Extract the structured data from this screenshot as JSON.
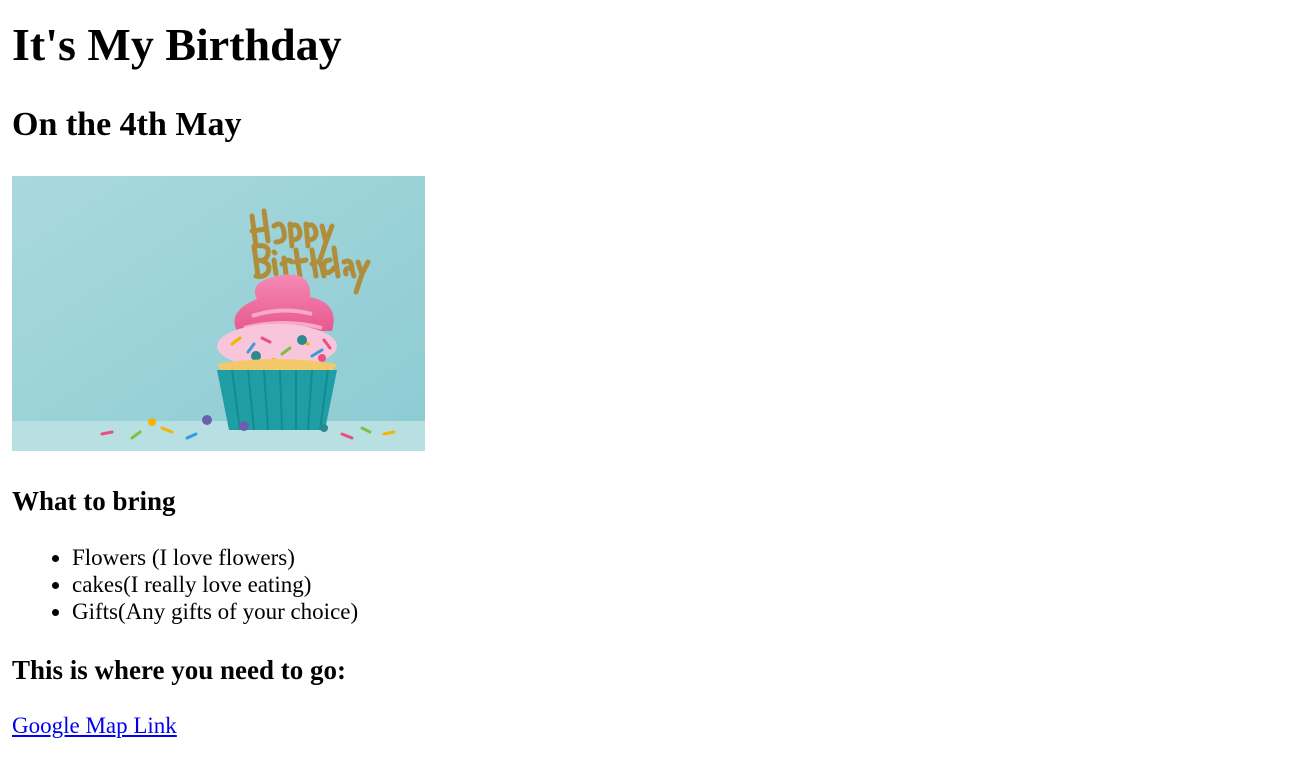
{
  "page": {
    "title": "It's My Birthday",
    "subtitle": "On the 4th May"
  },
  "hero_image": {
    "alt": "Happy Birthday",
    "topper_text": "Happy Birthday",
    "colors": {
      "background": "#9fd3d8",
      "frosting": "#f06aa3",
      "cup": "#1f9ea6",
      "gold": "#b08d3a"
    }
  },
  "bring": {
    "heading": "What to bring",
    "items": [
      "Flowers (I love flowers)",
      "cakes(I really love eating)",
      "Gifts(Any gifts of your choice)"
    ]
  },
  "directions": {
    "heading": "This is where you need to go:",
    "link_text": "Google Map Link"
  }
}
